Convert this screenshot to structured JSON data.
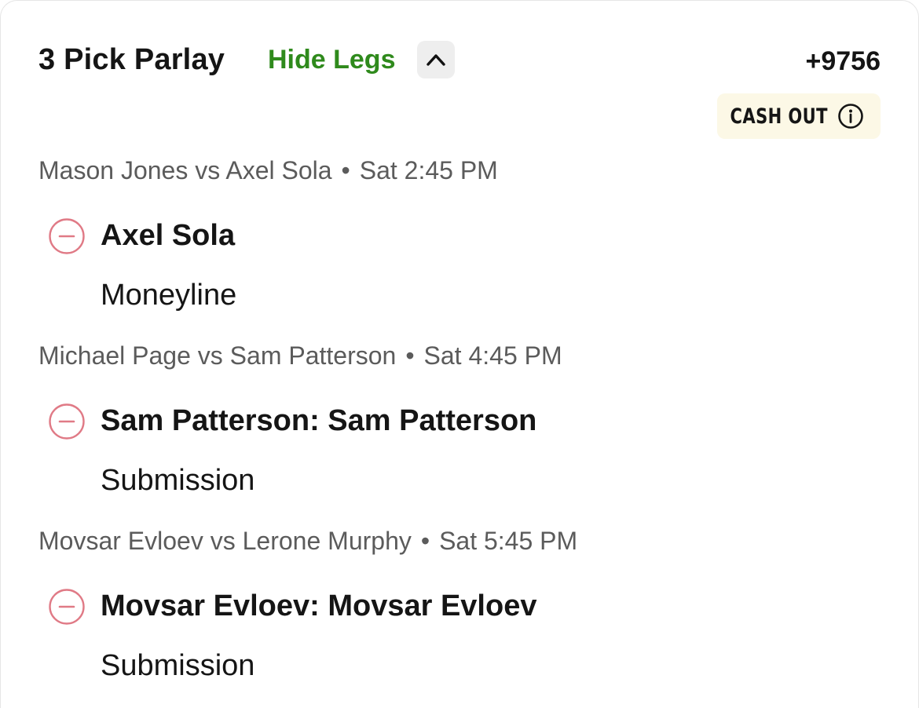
{
  "header": {
    "title": "3 Pick Parlay",
    "toggle_label": "Hide Legs",
    "toggle_icon": "chevron-up-icon",
    "odds": "+9756"
  },
  "cashout": {
    "label": "CASH OUT",
    "icon": "info-icon",
    "background": "#fcf8e6"
  },
  "colors": {
    "accent_green": "#2f8a1c",
    "remove_icon": "#e07a86"
  },
  "legs": [
    {
      "matchup": "Mason Jones vs Axel Sola",
      "time": "Sat 2:45 PM",
      "selection": "Axel Sola",
      "market": "Moneyline"
    },
    {
      "matchup": "Michael Page vs Sam Patterson",
      "time": "Sat 4:45 PM",
      "selection": "Sam Patterson: Sam Patterson",
      "market": "Submission"
    },
    {
      "matchup": "Movsar Evloev vs Lerone Murphy",
      "time": "Sat 5:45 PM",
      "selection": "Movsar Evloev: Movsar Evloev",
      "market": "Submission"
    }
  ]
}
